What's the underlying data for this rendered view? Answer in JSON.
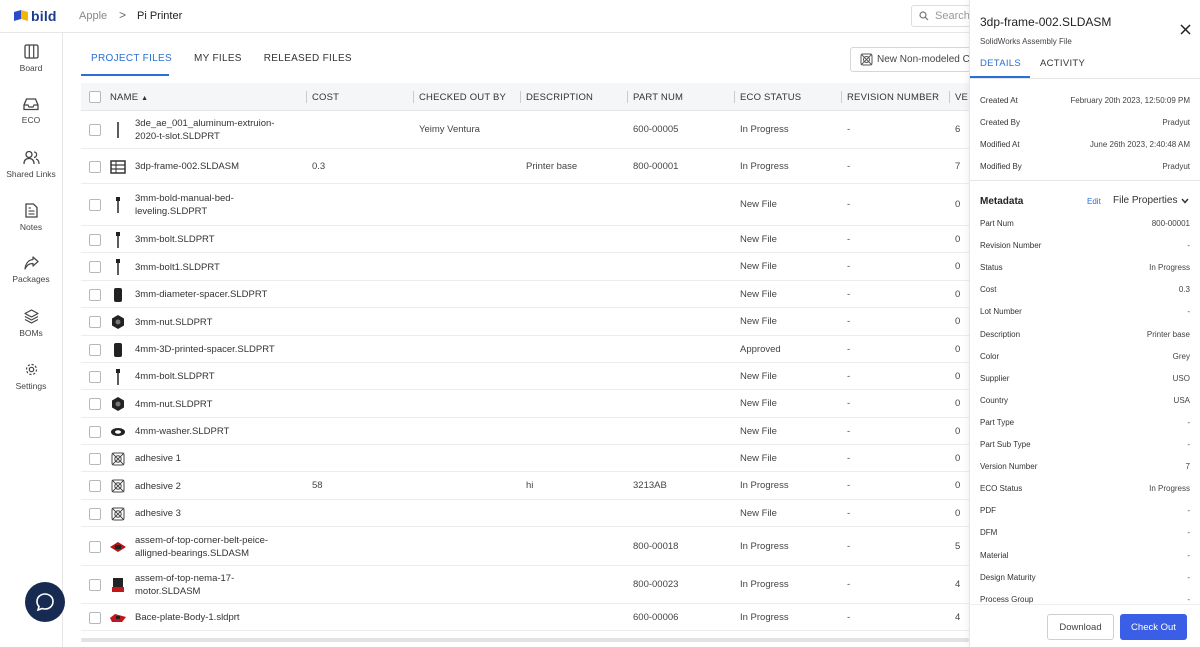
{
  "header": {
    "logo_text": "bild",
    "breadcrumb": [
      "Apple",
      "Pi Printer"
    ],
    "breadcrumb_sep": ">",
    "search_placeholder": "Search"
  },
  "sidebar": {
    "items": [
      {
        "label": "Board",
        "icon": "board-icon"
      },
      {
        "label": "ECO",
        "icon": "inbox-icon"
      },
      {
        "label": "Shared Links",
        "icon": "users-icon"
      },
      {
        "label": "Notes",
        "icon": "document-icon"
      },
      {
        "label": "Packages",
        "icon": "share-arrow-icon"
      },
      {
        "label": "BOMs",
        "icon": "layers-icon"
      },
      {
        "label": "Settings",
        "icon": "gear-icon"
      }
    ]
  },
  "main": {
    "tabs": [
      {
        "label": "PROJECT FILES",
        "active": true
      },
      {
        "label": "MY FILES",
        "active": false
      },
      {
        "label": "RELEASED FILES",
        "active": false
      }
    ],
    "non_modeled_button": "New Non-modeled C",
    "columns": [
      "NAME",
      "COST",
      "CHECKED OUT BY",
      "DESCRIPTION",
      "PART NUM",
      "ECO STATUS",
      "REVISION NUMBER",
      "VE"
    ],
    "sort_indicator": "▲",
    "rows": [
      {
        "name": "3de_ae_001_aluminum-extruion-2020-t-slot.SLDPRT",
        "cost": "",
        "checked_out_by": "Yeimy Ventura",
        "description": "",
        "part_num": "600-00005",
        "eco_status": "In Progress",
        "revision": "-",
        "version": "6",
        "thumb": "rod"
      },
      {
        "name": "3dp-frame-002.SLDASM",
        "cost": "0.3",
        "checked_out_by": "",
        "description": "Printer base",
        "part_num": "800-00001",
        "eco_status": "In Progress",
        "revision": "-",
        "version": "7",
        "thumb": "frame"
      },
      {
        "name": "3mm-bold-manual-bed-leveling.SLDPRT",
        "cost": "",
        "checked_out_by": "",
        "description": "",
        "part_num": "",
        "eco_status": "New File",
        "revision": "-",
        "version": "0",
        "thumb": "bolt"
      },
      {
        "name": "3mm-bolt.SLDPRT",
        "cost": "",
        "checked_out_by": "",
        "description": "",
        "part_num": "",
        "eco_status": "New File",
        "revision": "-",
        "version": "0",
        "thumb": "bolt"
      },
      {
        "name": "3mm-bolt1.SLDPRT",
        "cost": "",
        "checked_out_by": "",
        "description": "",
        "part_num": "",
        "eco_status": "New File",
        "revision": "-",
        "version": "0",
        "thumb": "bolt"
      },
      {
        "name": "3mm-diameter-spacer.SLDPRT",
        "cost": "",
        "checked_out_by": "",
        "description": "",
        "part_num": "",
        "eco_status": "New File",
        "revision": "-",
        "version": "0",
        "thumb": "spacer"
      },
      {
        "name": "3mm-nut.SLDPRT",
        "cost": "",
        "checked_out_by": "",
        "description": "",
        "part_num": "",
        "eco_status": "New File",
        "revision": "-",
        "version": "0",
        "thumb": "nut"
      },
      {
        "name": "4mm-3D-printed-spacer.SLDPRT",
        "cost": "",
        "checked_out_by": "",
        "description": "",
        "part_num": "",
        "eco_status": "Approved",
        "revision": "-",
        "version": "0",
        "thumb": "spacer"
      },
      {
        "name": "4mm-bolt.SLDPRT",
        "cost": "",
        "checked_out_by": "",
        "description": "",
        "part_num": "",
        "eco_status": "New File",
        "revision": "-",
        "version": "0",
        "thumb": "bolt"
      },
      {
        "name": "4mm-nut.SLDPRT",
        "cost": "",
        "checked_out_by": "",
        "description": "",
        "part_num": "",
        "eco_status": "New File",
        "revision": "-",
        "version": "0",
        "thumb": "nut"
      },
      {
        "name": "4mm-washer.SLDPRT",
        "cost": "",
        "checked_out_by": "",
        "description": "",
        "part_num": "",
        "eco_status": "New File",
        "revision": "-",
        "version": "0",
        "thumb": "washer"
      },
      {
        "name": "adhesive 1",
        "cost": "",
        "checked_out_by": "",
        "description": "",
        "part_num": "",
        "eco_status": "New File",
        "revision": "-",
        "version": "0",
        "thumb": "nonmodeled"
      },
      {
        "name": "adhesive 2",
        "cost": "58",
        "checked_out_by": "",
        "description": "hi",
        "part_num": "3213AB",
        "eco_status": "In Progress",
        "revision": "-",
        "version": "0",
        "thumb": "nonmodeled"
      },
      {
        "name": "adhesive 3",
        "cost": "",
        "checked_out_by": "",
        "description": "",
        "part_num": "",
        "eco_status": "New File",
        "revision": "-",
        "version": "0",
        "thumb": "nonmodeled"
      },
      {
        "name": "assem-of-top-corner-belt-peice-alligned-bearings.SLDASM",
        "cost": "",
        "checked_out_by": "",
        "description": "",
        "part_num": "800-00018",
        "eco_status": "In Progress",
        "revision": "-",
        "version": "5",
        "thumb": "redassy"
      },
      {
        "name": "assem-of-top-nema-17-motor.SLDASM",
        "cost": "",
        "checked_out_by": "",
        "description": "",
        "part_num": "800-00023",
        "eco_status": "In Progress",
        "revision": "-",
        "version": "4",
        "thumb": "motor"
      },
      {
        "name": "Bace-plate-Body-1.sldprt",
        "cost": "",
        "checked_out_by": "",
        "description": "",
        "part_num": "600-00006",
        "eco_status": "In Progress",
        "revision": "-",
        "version": "4",
        "thumb": "redplate"
      }
    ]
  },
  "panel": {
    "title": "3dp-frame-002.SLDASM",
    "subtitle": "SolidWorks Assembly File",
    "tabs": [
      "DETAILS",
      "ACTIVITY"
    ],
    "details": [
      {
        "k": "Created At",
        "v": "February 20th 2023, 12:50:09 PM"
      },
      {
        "k": "Created By",
        "v": "Pradyut"
      },
      {
        "k": "Modified At",
        "v": "June 26th 2023, 2:40:48 AM"
      },
      {
        "k": "Modified By",
        "v": "Pradyut"
      }
    ],
    "metadata_title": "Metadata",
    "edit_label": "Edit",
    "file_properties_label": "File Properties",
    "metadata": [
      {
        "k": "Part Num",
        "v": "800-00001"
      },
      {
        "k": "Revision Number",
        "v": "-"
      },
      {
        "k": "Status",
        "v": "In Progress"
      },
      {
        "k": "Cost",
        "v": "0.3"
      },
      {
        "k": "Lot Number",
        "v": "-"
      },
      {
        "k": "Description",
        "v": "Printer base"
      },
      {
        "k": "Color",
        "v": "Grey"
      },
      {
        "k": "Supplier",
        "v": "USO"
      },
      {
        "k": "Country",
        "v": "USA"
      },
      {
        "k": "Part Type",
        "v": "-"
      },
      {
        "k": "Part Sub Type",
        "v": "-"
      },
      {
        "k": "Version Number",
        "v": "7"
      },
      {
        "k": "ECO Status",
        "v": "In Progress"
      },
      {
        "k": "PDF",
        "v": "-"
      },
      {
        "k": "DFM",
        "v": "-"
      },
      {
        "k": "Material",
        "v": "-"
      },
      {
        "k": "Design Maturity",
        "v": "-"
      },
      {
        "k": "Process Group",
        "v": "-"
      }
    ],
    "download_label": "Download",
    "checkout_label": "Check Out"
  },
  "colors": {
    "accent": "#2a6fd6",
    "primary_button": "#3a5ee6",
    "chat_button": "#162a52"
  }
}
